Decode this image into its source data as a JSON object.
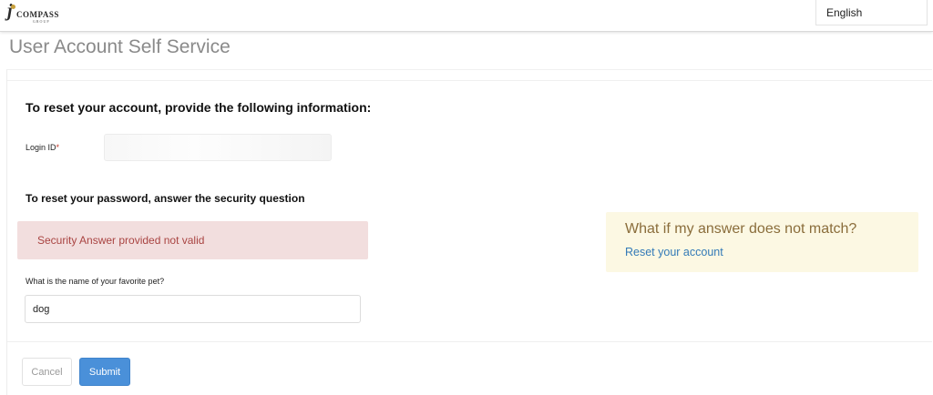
{
  "header": {
    "logo": {
      "mark": "j",
      "word": "COMPASS",
      "sub": "GROUP"
    },
    "language": "English"
  },
  "page": {
    "title": "User Account Self Service"
  },
  "form": {
    "reset_heading": "To reset your account, provide the following information:",
    "login_label": "Login ID",
    "login_required_mark": "*",
    "login_value": "",
    "password_heading": "To reset your password, answer the security question",
    "error_message": "Security Answer provided not valid",
    "question_label": "What is the name of your favorite pet?",
    "answer_value": "dog"
  },
  "help": {
    "title": "What if my answer does not match?",
    "link": "Reset your account"
  },
  "buttons": {
    "cancel": "Cancel",
    "submit": "Submit"
  },
  "colors": {
    "error_bg": "#f2dede",
    "error_text": "#a94442",
    "help_bg": "#fcf8e3",
    "help_title": "#8a6d3b",
    "link": "#337ab7",
    "primary": "#4a90d9"
  }
}
